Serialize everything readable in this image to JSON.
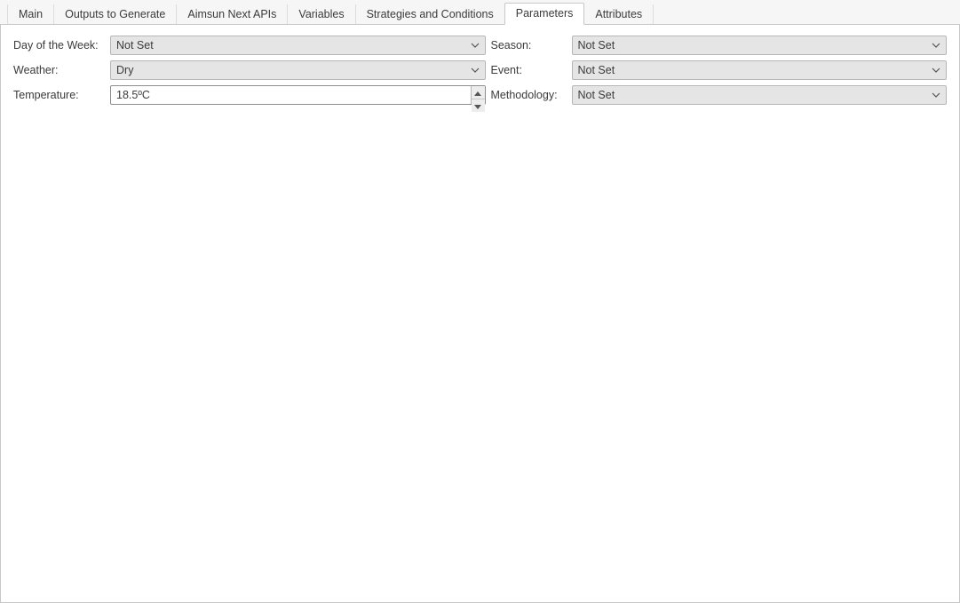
{
  "tabs": [
    {
      "label": "Main"
    },
    {
      "label": "Outputs to Generate"
    },
    {
      "label": "Aimsun Next APIs"
    },
    {
      "label": "Variables"
    },
    {
      "label": "Strategies and Conditions"
    },
    {
      "label": "Parameters"
    },
    {
      "label": "Attributes"
    }
  ],
  "active_tab_index": 5,
  "params": {
    "day_of_week": {
      "label": "Day of the Week:",
      "value": "Not Set"
    },
    "season": {
      "label": "Season:",
      "value": "Not Set"
    },
    "weather": {
      "label": "Weather:",
      "value": "Dry"
    },
    "event": {
      "label": "Event:",
      "value": "Not Set"
    },
    "temperature": {
      "label": "Temperature:",
      "value": "18.5ºC"
    },
    "methodology": {
      "label": "Methodology:",
      "value": "Not Set"
    }
  }
}
